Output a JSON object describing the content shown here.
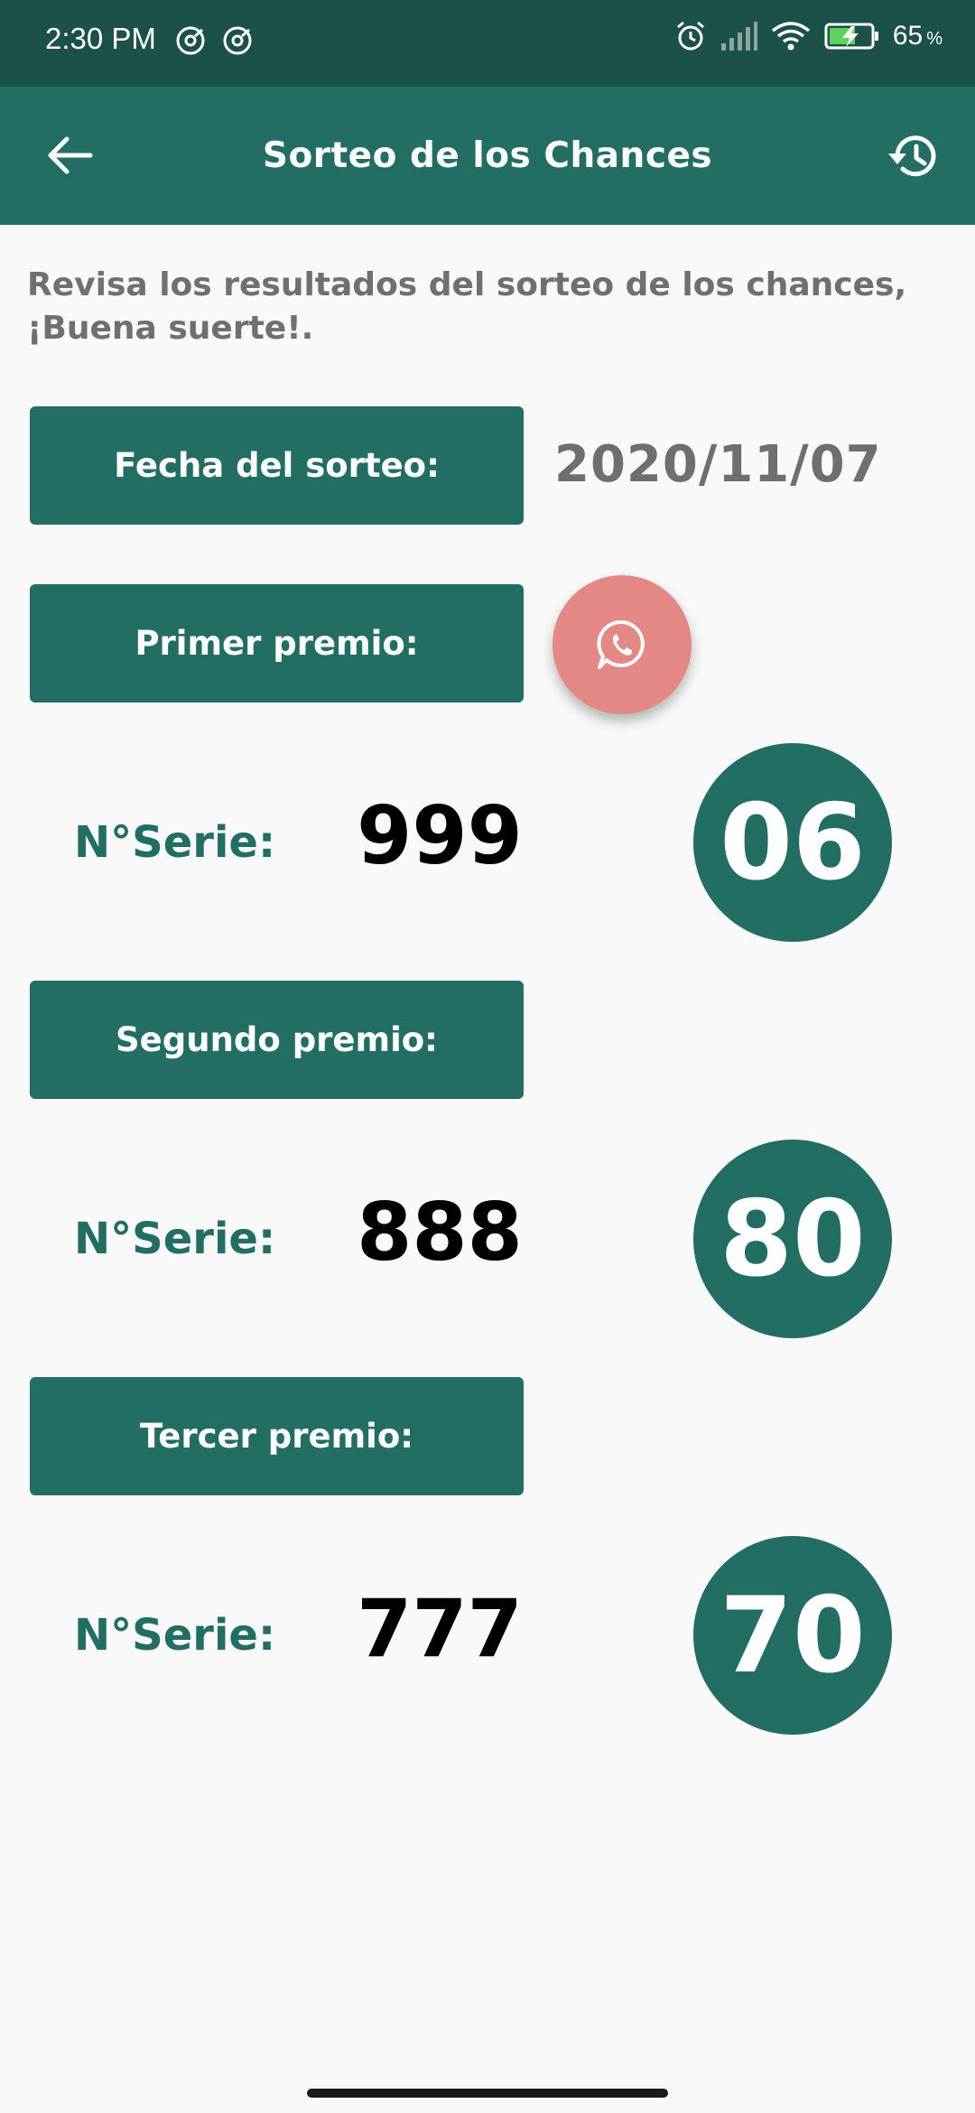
{
  "status_bar": {
    "time": "2:30 PM",
    "battery_percent": "65",
    "battery_unit": "%",
    "icons": [
      "at-sign-icon",
      "at-sign-icon",
      "alarm-icon",
      "signal-icon",
      "wifi-icon",
      "battery-charging-icon"
    ]
  },
  "app_bar": {
    "title": "Sorteo de los Chances",
    "back_icon": "arrow-left-icon",
    "history_icon": "history-icon"
  },
  "intro": {
    "text": "Revisa los resultados del sorteo de los chances, ¡Buena suerte!."
  },
  "draw": {
    "date_label": "Fecha del sorteo:",
    "date_value": "2020/11/07"
  },
  "prizes": [
    {
      "label": "Primer premio:",
      "serie_label": "N°Serie:",
      "serie_value": "999",
      "number": "06"
    },
    {
      "label": "Segundo premio:",
      "serie_label": "N°Serie:",
      "serie_value": "888",
      "number": "80"
    },
    {
      "label": "Tercer premio:",
      "serie_label": "N°Serie:",
      "serie_value": "777",
      "number": "70"
    }
  ],
  "fab": {
    "icon": "whatsapp-icon"
  },
  "colors": {
    "status_bar": "#1b5148",
    "primary": "#226e63",
    "fab": "#e48885",
    "background": "#f9f9f9"
  }
}
